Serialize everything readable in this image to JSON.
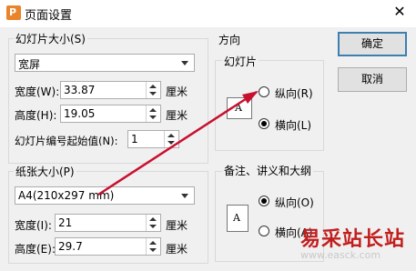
{
  "window": {
    "title": "页面设置",
    "app_icon": "P",
    "close": "✕"
  },
  "slide_size": {
    "legend": "幻灯片大小(S)",
    "preset": "宽屏",
    "width_label": "宽度(W):",
    "width_value": "33.87",
    "width_unit": "厘米",
    "height_label": "高度(H):",
    "height_value": "19.05",
    "height_unit": "厘米",
    "start_num_label": "幻灯片编号起始值(N):",
    "start_num_value": "1"
  },
  "paper_size": {
    "legend": "纸张大小(P)",
    "preset": "A4(210x297 mm)",
    "width_label": "宽度(I):",
    "width_value": "21",
    "width_unit": "厘米",
    "height_label": "高度(E):",
    "height_value": "29.7",
    "height_unit": "厘米"
  },
  "orientation": {
    "title": "方向",
    "slides": {
      "legend": "幻灯片",
      "portrait": "纵向(R)",
      "landscape": "横向(L)",
      "selected": "landscape",
      "icon_letter": "A"
    },
    "notes": {
      "legend": "备注、讲义和大纲",
      "portrait": "纵向(O)",
      "landscape": "横向(A)",
      "selected": "portrait",
      "icon_letter": "A"
    }
  },
  "buttons": {
    "ok": "确定",
    "cancel": "取消"
  },
  "watermark": {
    "text": "易采站长站",
    "url": "www.easck.com"
  },
  "colors": {
    "annotation_arrow": "#c8102e",
    "default_button_border": "#3c7fb1"
  }
}
